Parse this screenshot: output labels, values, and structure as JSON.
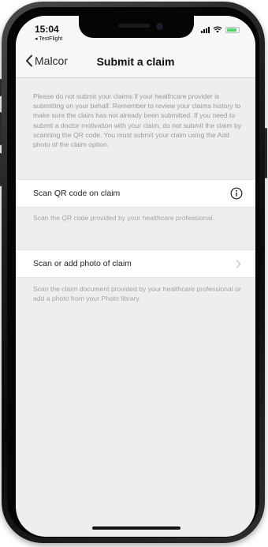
{
  "status_bar": {
    "time": "15:04",
    "back_app": "◂ TestFlight"
  },
  "nav": {
    "back_label": "Malcor",
    "title": "Submit a claim"
  },
  "intro_text": "Please do not submit your claims if your healthcare provider is submitting on your behalf. Remember to review your claims history to make sure the claim has not already been submitted. If you need to submit a doctor motivation with your claim, do not submit the claim by scanning the QR code. You must submit your claim using the Add photo of the claim option.",
  "options": [
    {
      "label": "Scan QR code on claim",
      "caption": "Scan the QR code provided by your healthcare professional.",
      "icon": "info-circle-icon"
    },
    {
      "label": "Scan or add photo of claim",
      "caption": "Scan the claim document provided by your healthcare professional or add a photo from your Photo library.",
      "icon": "chevron-right-icon"
    }
  ],
  "colors": {
    "screen_background": "#eeeeee",
    "row_background": "#ffffff",
    "battery": "#4cd964",
    "muted_text": "#9a9a9a"
  }
}
